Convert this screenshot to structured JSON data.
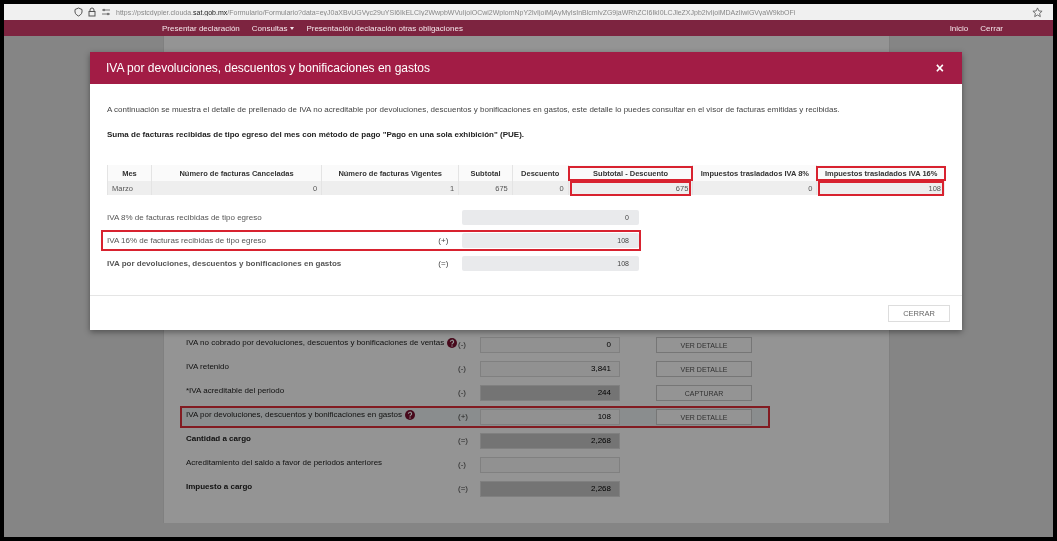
{
  "browser": {
    "url_prefix": "https://pstcdypier.clouda.",
    "url_domain": "sat.gob.mx",
    "url_rest": "/Formulario/Formulario?data=eyJ0aXBvUGVyc29uYSI6IkELCIy2WwpbWVuIjoiOCwi2WplomNpY2lvIjoiMjAyMyIsInBlcmlvZG9jaWRhZCI6IkI0LCJleZXJpb2lvIjoiMDAzIiwiGVyaW9kbOFi"
  },
  "nav": {
    "items": [
      {
        "label": "Presentar declaración",
        "kind": "link"
      },
      {
        "label": "Consultas",
        "kind": "menu"
      },
      {
        "label": "Presentación declaración otras obligaciones",
        "kind": "link"
      }
    ],
    "right_items": [
      "Inicio",
      "Cerrar"
    ]
  },
  "background_form": {
    "rows": [
      {
        "label": "IVA no cobrado por devoluciones, descuentos y bonificaciones de ventas",
        "bold": false,
        "help": true,
        "sign": "(-)",
        "value": "0",
        "readonly": false,
        "button": "VER DETALLE",
        "highlighted": false
      },
      {
        "label": "IVA retenido",
        "bold": false,
        "sign": "(-)",
        "value": "3,841",
        "readonly": false,
        "button": "VER DETALLE",
        "highlighted": false
      },
      {
        "label": "*IVA acreditable del periodo",
        "bold": false,
        "sign": "(-)",
        "value": "244",
        "readonly": true,
        "button": "CAPTURAR",
        "highlighted": false
      },
      {
        "label": "IVA por devoluciones, descuentos y bonificaciones en gastos",
        "bold": false,
        "help": true,
        "sign": "(+)",
        "value": "108",
        "readonly": false,
        "button": "VER DETALLE",
        "highlighted": true
      },
      {
        "label": "Cantidad a cargo",
        "bold": true,
        "sign": "(=)",
        "value": "2,268",
        "readonly": true,
        "highlighted": false
      },
      {
        "label": "Acreditamiento del saldo a favor de periodos anteriores",
        "bold": false,
        "sign": "(-)",
        "readonly": false,
        "highlighted": false
      },
      {
        "label": "Impuesto a cargo",
        "bold": true,
        "sign": "(=)",
        "value": "2,268",
        "readonly": true,
        "highlighted": false
      }
    ]
  },
  "modal": {
    "title": "IVA por devoluciones, descuentos y bonificaciones en gastos",
    "close": "×",
    "intro": "A continuación se muestra el detalle de prellenado de IVA no acreditable por devoluciones, descuentos y bonificaciones en gastos, este detalle lo puedes consultar en el visor de facturas emitidas y recibidas.",
    "subtitle": "Suma de facturas recibidas de tipo egreso del mes con método de pago \"Pago en una sola exhibición\" (PUE).",
    "table": {
      "columns": [
        {
          "label": "Mes",
          "highlighted": false
        },
        {
          "label": "Número de facturas Canceladas",
          "highlighted": false
        },
        {
          "label": "Número de facturas Vigentes",
          "highlighted": false
        },
        {
          "label": "Subtotal",
          "highlighted": false
        },
        {
          "label": "Descuento",
          "highlighted": false
        },
        {
          "label": "Subtotal - Descuento",
          "highlighted": true
        },
        {
          "label": "Impuestos trasladados IVA 8%",
          "highlighted": false
        },
        {
          "label": "Impuestos trasladados IVA 16%",
          "highlighted": true
        }
      ],
      "rows": [
        [
          "Marzo",
          "0",
          "1",
          "675",
          "0",
          "675",
          "0",
          "108"
        ]
      ]
    },
    "fields": [
      {
        "label": "IVA 8% de facturas recibidas de tipo egreso",
        "bold": false,
        "value": "0",
        "highlighted": false
      },
      {
        "label": "IVA 16% de facturas recibidas de tipo egreso",
        "bold": false,
        "sign": "(+)",
        "value": "108",
        "highlighted": true
      },
      {
        "label": "IVA por devoluciones, descuentos y bonificaciones en gastos",
        "bold": true,
        "sign": "(=)",
        "value": "108",
        "highlighted": false
      }
    ],
    "button": "CERRAR"
  }
}
